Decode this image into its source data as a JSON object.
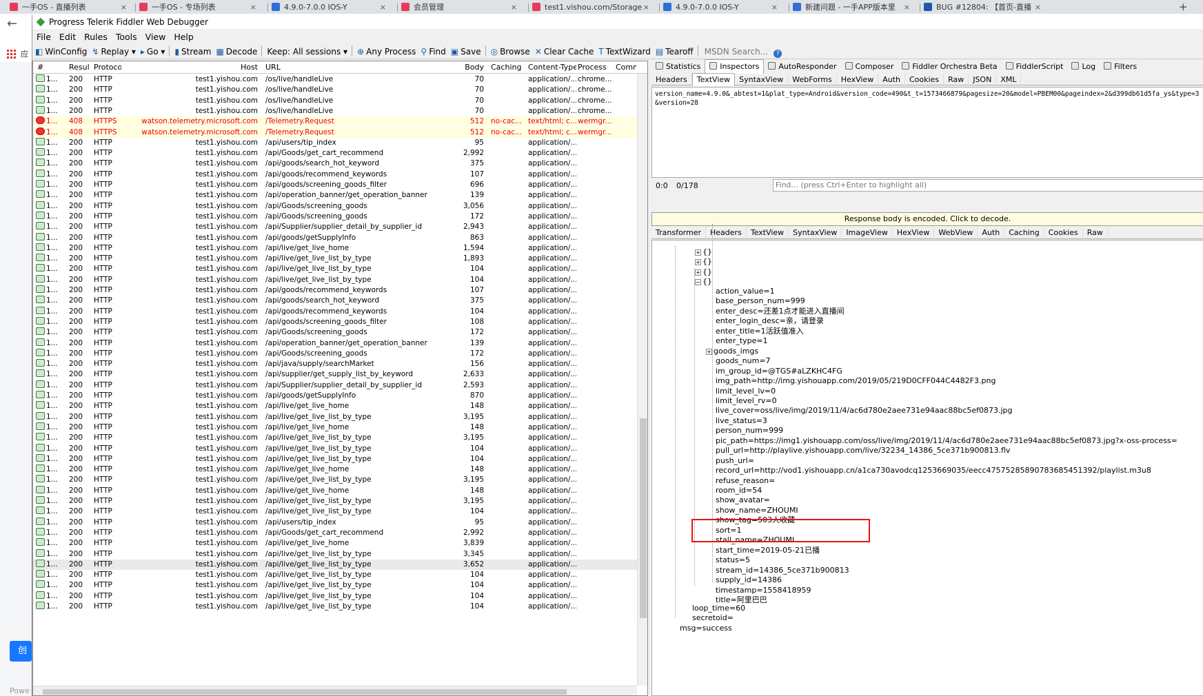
{
  "browser": {
    "tabs": [
      {
        "title": "一手OS - 直播列表",
        "favicon_color": "#e83a5a"
      },
      {
        "title": "一手OS - 专场列表",
        "favicon_color": "#e83a5a"
      },
      {
        "title": "4.9.0-7.0.0 IOS-Y",
        "favicon_color": "#2f6fd6"
      },
      {
        "title": "会员管理",
        "favicon_color": "#e83a5a"
      },
      {
        "title": "test1.vishou.com/Storage",
        "favicon_color": "#e83a5a"
      },
      {
        "title": "4.9.0-7.0.0 IOS-Y",
        "favicon_color": "#2f6fd6"
      },
      {
        "title": "新建问题 - 一手APP版本里",
        "favicon_color": "#2f6fd6"
      },
      {
        "title": "BUG #12804: 【首页-直播",
        "favicon_color": "#1c5aa8"
      }
    ],
    "apps_label": "应",
    "left_button": "创",
    "left_footer": "Powe"
  },
  "fiddler": {
    "title": "Progress Telerik Fiddler Web Debugger",
    "menu": [
      "File",
      "Edit",
      "Rules",
      "Tools",
      "View",
      "Help"
    ],
    "toolbar": [
      "WinConfig",
      "Replay",
      "Go",
      "Stream",
      "Decode",
      "Keep: All sessions",
      "Any Process",
      "Find",
      "Save",
      "Browse",
      "Clear Cache",
      "TextWizard",
      "Tearoff"
    ],
    "msdn_placeholder": "MSDN Search...",
    "columns": [
      "#",
      "Result",
      "Protocol",
      "Host",
      "URL",
      "Body",
      "Caching",
      "Content-Type",
      "Process",
      "Comme"
    ],
    "sessions": [
      {
        "num": "1...",
        "result": "200",
        "protocol": "HTTP",
        "host": "test1.yishou.com",
        "url": "/os/live/handleLive",
        "body": "70",
        "caching": "",
        "ctype": "application/...",
        "process": "chrome...",
        "status": "ok"
      },
      {
        "num": "1...",
        "result": "200",
        "protocol": "HTTP",
        "host": "test1.yishou.com",
        "url": "/os/live/handleLive",
        "body": "70",
        "caching": "",
        "ctype": "application/...",
        "process": "chrome...",
        "status": "ok"
      },
      {
        "num": "1...",
        "result": "200",
        "protocol": "HTTP",
        "host": "test1.yishou.com",
        "url": "/os/live/handleLive",
        "body": "70",
        "caching": "",
        "ctype": "application/...",
        "process": "chrome...",
        "status": "ok"
      },
      {
        "num": "1...",
        "result": "200",
        "protocol": "HTTP",
        "host": "test1.yishou.com",
        "url": "/os/live/handleLive",
        "body": "70",
        "caching": "",
        "ctype": "application/...",
        "process": "chrome...",
        "status": "ok"
      },
      {
        "num": "1...",
        "result": "408",
        "protocol": "HTTPS",
        "host": "watson.telemetry.microsoft.com",
        "url": "/Telemetry.Request",
        "body": "512",
        "caching": "no-cac...",
        "ctype": "text/html; c...",
        "process": "wermgr...",
        "status": "err"
      },
      {
        "num": "1...",
        "result": "408",
        "protocol": "HTTPS",
        "host": "watson.telemetry.microsoft.com",
        "url": "/Telemetry.Request",
        "body": "512",
        "caching": "no-cac...",
        "ctype": "text/html; c...",
        "process": "wermgr...",
        "status": "err"
      },
      {
        "num": "1...",
        "result": "200",
        "protocol": "HTTP",
        "host": "test1.yishou.com",
        "url": "/api/users/tip_index",
        "body": "95",
        "caching": "",
        "ctype": "application/...",
        "process": "",
        "status": "ok"
      },
      {
        "num": "1...",
        "result": "200",
        "protocol": "HTTP",
        "host": "test1.yishou.com",
        "url": "/api/Goods/get_cart_recommend",
        "body": "2,992",
        "caching": "",
        "ctype": "application/...",
        "process": "",
        "status": "ok"
      },
      {
        "num": "1...",
        "result": "200",
        "protocol": "HTTP",
        "host": "test1.yishou.com",
        "url": "/api/goods/search_hot_keyword",
        "body": "375",
        "caching": "",
        "ctype": "application/...",
        "process": "",
        "status": "ok"
      },
      {
        "num": "1...",
        "result": "200",
        "protocol": "HTTP",
        "host": "test1.yishou.com",
        "url": "/api/goods/recommend_keywords",
        "body": "107",
        "caching": "",
        "ctype": "application/...",
        "process": "",
        "status": "ok"
      },
      {
        "num": "1...",
        "result": "200",
        "protocol": "HTTP",
        "host": "test1.yishou.com",
        "url": "/api/goods/screening_goods_filter",
        "body": "696",
        "caching": "",
        "ctype": "application/...",
        "process": "",
        "status": "ok"
      },
      {
        "num": "1...",
        "result": "200",
        "protocol": "HTTP",
        "host": "test1.yishou.com",
        "url": "/api/operation_banner/get_operation_banner",
        "body": "139",
        "caching": "",
        "ctype": "application/...",
        "process": "",
        "status": "ok"
      },
      {
        "num": "1...",
        "result": "200",
        "protocol": "HTTP",
        "host": "test1.yishou.com",
        "url": "/api/Goods/screening_goods",
        "body": "3,056",
        "caching": "",
        "ctype": "application/...",
        "process": "",
        "status": "ok"
      },
      {
        "num": "1...",
        "result": "200",
        "protocol": "HTTP",
        "host": "test1.yishou.com",
        "url": "/api/Goods/screening_goods",
        "body": "172",
        "caching": "",
        "ctype": "application/...",
        "process": "",
        "status": "ok"
      },
      {
        "num": "1...",
        "result": "200",
        "protocol": "HTTP",
        "host": "test1.yishou.com",
        "url": "/api/Supplier/supplier_detail_by_supplier_id",
        "body": "2,943",
        "caching": "",
        "ctype": "application/...",
        "process": "",
        "status": "ok"
      },
      {
        "num": "1...",
        "result": "200",
        "protocol": "HTTP",
        "host": "test1.yishou.com",
        "url": "/api/goods/getSupplyInfo",
        "body": "863",
        "caching": "",
        "ctype": "application/...",
        "process": "",
        "status": "ok"
      },
      {
        "num": "1...",
        "result": "200",
        "protocol": "HTTP",
        "host": "test1.yishou.com",
        "url": "/api/live/get_live_home",
        "body": "1,594",
        "caching": "",
        "ctype": "application/...",
        "process": "",
        "status": "ok"
      },
      {
        "num": "1...",
        "result": "200",
        "protocol": "HTTP",
        "host": "test1.yishou.com",
        "url": "/api/live/get_live_list_by_type",
        "body": "1,893",
        "caching": "",
        "ctype": "application/...",
        "process": "",
        "status": "ok"
      },
      {
        "num": "1...",
        "result": "200",
        "protocol": "HTTP",
        "host": "test1.yishou.com",
        "url": "/api/live/get_live_list_by_type",
        "body": "104",
        "caching": "",
        "ctype": "application/...",
        "process": "",
        "status": "ok"
      },
      {
        "num": "1...",
        "result": "200",
        "protocol": "HTTP",
        "host": "test1.yishou.com",
        "url": "/api/live/get_live_list_by_type",
        "body": "104",
        "caching": "",
        "ctype": "application/...",
        "process": "",
        "status": "ok"
      },
      {
        "num": "1...",
        "result": "200",
        "protocol": "HTTP",
        "host": "test1.yishou.com",
        "url": "/api/goods/recommend_keywords",
        "body": "107",
        "caching": "",
        "ctype": "application/...",
        "process": "",
        "status": "ok"
      },
      {
        "num": "1...",
        "result": "200",
        "protocol": "HTTP",
        "host": "test1.yishou.com",
        "url": "/api/goods/search_hot_keyword",
        "body": "375",
        "caching": "",
        "ctype": "application/...",
        "process": "",
        "status": "ok"
      },
      {
        "num": "1...",
        "result": "200",
        "protocol": "HTTP",
        "host": "test1.yishou.com",
        "url": "/api/goods/recommend_keywords",
        "body": "104",
        "caching": "",
        "ctype": "application/...",
        "process": "",
        "status": "ok"
      },
      {
        "num": "1...",
        "result": "200",
        "protocol": "HTTP",
        "host": "test1.yishou.com",
        "url": "/api/goods/screening_goods_filter",
        "body": "108",
        "caching": "",
        "ctype": "application/...",
        "process": "",
        "status": "ok"
      },
      {
        "num": "1...",
        "result": "200",
        "protocol": "HTTP",
        "host": "test1.yishou.com",
        "url": "/api/Goods/screening_goods",
        "body": "172",
        "caching": "",
        "ctype": "application/...",
        "process": "",
        "status": "ok"
      },
      {
        "num": "1...",
        "result": "200",
        "protocol": "HTTP",
        "host": "test1.yishou.com",
        "url": "/api/operation_banner/get_operation_banner",
        "body": "139",
        "caching": "",
        "ctype": "application/...",
        "process": "",
        "status": "ok"
      },
      {
        "num": "1...",
        "result": "200",
        "protocol": "HTTP",
        "host": "test1.yishou.com",
        "url": "/api/Goods/screening_goods",
        "body": "172",
        "caching": "",
        "ctype": "application/...",
        "process": "",
        "status": "ok"
      },
      {
        "num": "1...",
        "result": "200",
        "protocol": "HTTP",
        "host": "test1.yishou.com",
        "url": "/api/java/supply/searchMarket",
        "body": "156",
        "caching": "",
        "ctype": "application/...",
        "process": "",
        "status": "ok"
      },
      {
        "num": "1...",
        "result": "200",
        "protocol": "HTTP",
        "host": "test1.yishou.com",
        "url": "/api/supplier/get_supply_list_by_keyword",
        "body": "2,633",
        "caching": "",
        "ctype": "application/...",
        "process": "",
        "status": "ok"
      },
      {
        "num": "1...",
        "result": "200",
        "protocol": "HTTP",
        "host": "test1.yishou.com",
        "url": "/api/Supplier/supplier_detail_by_supplier_id",
        "body": "2,593",
        "caching": "",
        "ctype": "application/...",
        "process": "",
        "status": "ok"
      },
      {
        "num": "1...",
        "result": "200",
        "protocol": "HTTP",
        "host": "test1.yishou.com",
        "url": "/api/goods/getSupplyInfo",
        "body": "870",
        "caching": "",
        "ctype": "application/...",
        "process": "",
        "status": "ok"
      },
      {
        "num": "1...",
        "result": "200",
        "protocol": "HTTP",
        "host": "test1.yishou.com",
        "url": "/api/live/get_live_home",
        "body": "148",
        "caching": "",
        "ctype": "application/...",
        "process": "",
        "status": "ok"
      },
      {
        "num": "1...",
        "result": "200",
        "protocol": "HTTP",
        "host": "test1.yishou.com",
        "url": "/api/live/get_live_list_by_type",
        "body": "3,195",
        "caching": "",
        "ctype": "application/...",
        "process": "",
        "status": "ok"
      },
      {
        "num": "1...",
        "result": "200",
        "protocol": "HTTP",
        "host": "test1.yishou.com",
        "url": "/api/live/get_live_home",
        "body": "148",
        "caching": "",
        "ctype": "application/...",
        "process": "",
        "status": "ok"
      },
      {
        "num": "1...",
        "result": "200",
        "protocol": "HTTP",
        "host": "test1.yishou.com",
        "url": "/api/live/get_live_list_by_type",
        "body": "3,195",
        "caching": "",
        "ctype": "application/...",
        "process": "",
        "status": "ok"
      },
      {
        "num": "1...",
        "result": "200",
        "protocol": "HTTP",
        "host": "test1.yishou.com",
        "url": "/api/live/get_live_list_by_type",
        "body": "104",
        "caching": "",
        "ctype": "application/...",
        "process": "",
        "status": "ok"
      },
      {
        "num": "1...",
        "result": "200",
        "protocol": "HTTP",
        "host": "test1.yishou.com",
        "url": "/api/live/get_live_list_by_type",
        "body": "104",
        "caching": "",
        "ctype": "application/...",
        "process": "",
        "status": "ok"
      },
      {
        "num": "1...",
        "result": "200",
        "protocol": "HTTP",
        "host": "test1.yishou.com",
        "url": "/api/live/get_live_home",
        "body": "148",
        "caching": "",
        "ctype": "application/...",
        "process": "",
        "status": "ok"
      },
      {
        "num": "1...",
        "result": "200",
        "protocol": "HTTP",
        "host": "test1.yishou.com",
        "url": "/api/live/get_live_list_by_type",
        "body": "3,195",
        "caching": "",
        "ctype": "application/...",
        "process": "",
        "status": "ok"
      },
      {
        "num": "1...",
        "result": "200",
        "protocol": "HTTP",
        "host": "test1.yishou.com",
        "url": "/api/live/get_live_home",
        "body": "148",
        "caching": "",
        "ctype": "application/...",
        "process": "",
        "status": "ok"
      },
      {
        "num": "1...",
        "result": "200",
        "protocol": "HTTP",
        "host": "test1.yishou.com",
        "url": "/api/live/get_live_list_by_type",
        "body": "3,195",
        "caching": "",
        "ctype": "application/...",
        "process": "",
        "status": "ok"
      },
      {
        "num": "1...",
        "result": "200",
        "protocol": "HTTP",
        "host": "test1.yishou.com",
        "url": "/api/live/get_live_list_by_type",
        "body": "104",
        "caching": "",
        "ctype": "application/...",
        "process": "",
        "status": "ok"
      },
      {
        "num": "1...",
        "result": "200",
        "protocol": "HTTP",
        "host": "test1.yishou.com",
        "url": "/api/users/tip_index",
        "body": "95",
        "caching": "",
        "ctype": "application/...",
        "process": "",
        "status": "ok"
      },
      {
        "num": "1...",
        "result": "200",
        "protocol": "HTTP",
        "host": "test1.yishou.com",
        "url": "/api/Goods/get_cart_recommend",
        "body": "2,992",
        "caching": "",
        "ctype": "application/...",
        "process": "",
        "status": "ok"
      },
      {
        "num": "1...",
        "result": "200",
        "protocol": "HTTP",
        "host": "test1.yishou.com",
        "url": "/api/live/get_live_home",
        "body": "3,839",
        "caching": "",
        "ctype": "application/...",
        "process": "",
        "status": "ok"
      },
      {
        "num": "1...",
        "result": "200",
        "protocol": "HTTP",
        "host": "test1.yishou.com",
        "url": "/api/live/get_live_list_by_type",
        "body": "3,345",
        "caching": "",
        "ctype": "application/...",
        "process": "",
        "status": "ok"
      },
      {
        "num": "1...",
        "result": "200",
        "protocol": "HTTP",
        "host": "test1.yishou.com",
        "url": "/api/live/get_live_list_by_type",
        "body": "3,652",
        "caching": "",
        "ctype": "application/...",
        "process": "",
        "status": "sel"
      },
      {
        "num": "1...",
        "result": "200",
        "protocol": "HTTP",
        "host": "test1.yishou.com",
        "url": "/api/live/get_live_list_by_type",
        "body": "104",
        "caching": "",
        "ctype": "application/...",
        "process": "",
        "status": "ok"
      },
      {
        "num": "1...",
        "result": "200",
        "protocol": "HTTP",
        "host": "test1.yishou.com",
        "url": "/api/live/get_live_list_by_type",
        "body": "104",
        "caching": "",
        "ctype": "application/...",
        "process": "",
        "status": "ok"
      },
      {
        "num": "1...",
        "result": "200",
        "protocol": "HTTP",
        "host": "test1.yishou.com",
        "url": "/api/live/get_live_list_by_type",
        "body": "104",
        "caching": "",
        "ctype": "application/...",
        "process": "",
        "status": "ok"
      },
      {
        "num": "1...",
        "result": "200",
        "protocol": "HTTP",
        "host": "test1.yishou.com",
        "url": "/api/live/get_live_list_by_type",
        "body": "104",
        "caching": "",
        "ctype": "application/...",
        "process": "",
        "status": "ok"
      }
    ],
    "inspector_tabs": [
      "Statistics",
      "Inspectors",
      "AutoResponder",
      "Composer",
      "Fiddler Orchestra Beta",
      "FiddlerScript",
      "Log",
      "Filters"
    ],
    "request_tabs": [
      "Headers",
      "TextView",
      "SyntaxView",
      "WebForms",
      "HexView",
      "Auth",
      "Cookies",
      "Raw",
      "JSON",
      "XML"
    ],
    "request_text": "version_name=4.9.0&_abtest=1&plat_type=Android&version_code=490&t_t=1573466879&pagesize=20&model=PBEM00&pageindex=2&d399db61d5fa_ys&type=3&version=28",
    "request_status": {
      "pos": "0:0",
      "count": "0/178",
      "find_placeholder": "Find... (press Ctrl+Enter to highlight all)"
    },
    "encoded_banner": "Response body is encoded. Click to decode.",
    "response_tabs": [
      "Transformer",
      "Headers",
      "TextView",
      "SyntaxView",
      "ImageView",
      "HexView",
      "WebView",
      "Auth",
      "Caching",
      "Cookies",
      "Raw"
    ],
    "tree": {
      "collapsed": [
        "{}",
        "{}",
        "{}"
      ],
      "open_node": "{}",
      "fields": [
        "action_value=1",
        "base_person_num=999",
        "enter_desc=还差1点才能进入直播间",
        "enter_login_desc=亲，请登录",
        "enter_title=1活跃值准入",
        "enter_type=1",
        "goods_imgs",
        "goods_num=7",
        "im_group_id=@TGS#aLZKHC4FG",
        "img_path=http://img.yishouapp.com/2019/05/219D0CFF044C4482F3.png",
        "limit_level_lv=0",
        "limit_level_rv=0",
        "live_cover=oss/live/img/2019/11/4/ac6d780e2aee731e94aac88bc5ef0873.jpg",
        "live_status=3",
        "person_num=999",
        "pic_path=https://img1.yishouapp.com/oss/live/img/2019/11/4/ac6d780e2aee731e94aac88bc5ef0873.jpg?x-oss-process=",
        "pull_url=http://playlive.yishouapp.com/live/32234_14386_5ce371b900813.flv",
        "push_url=",
        "record_url=http://vod1.yishouapp.cn/a1ca730avodcq1253669035/eecc4757528589078368545​1392/playlist.m3u8",
        "refuse_reason=",
        "room_id=54",
        "show_avatar=",
        "show_name=ZHOUMI",
        "show_tag=503人收藏",
        "sort=1",
        "stall_name=ZHOUMI",
        "start_time=2019-05-21已播",
        "status=5",
        "stream_id=14386_5ce371b900813",
        "supply_id=14386",
        "timestamp=1558418959",
        "title=阿里巴巴"
      ],
      "loop_time": "loop_time=60",
      "secretoid": "secretoid=",
      "msg": "msg=success"
    }
  }
}
